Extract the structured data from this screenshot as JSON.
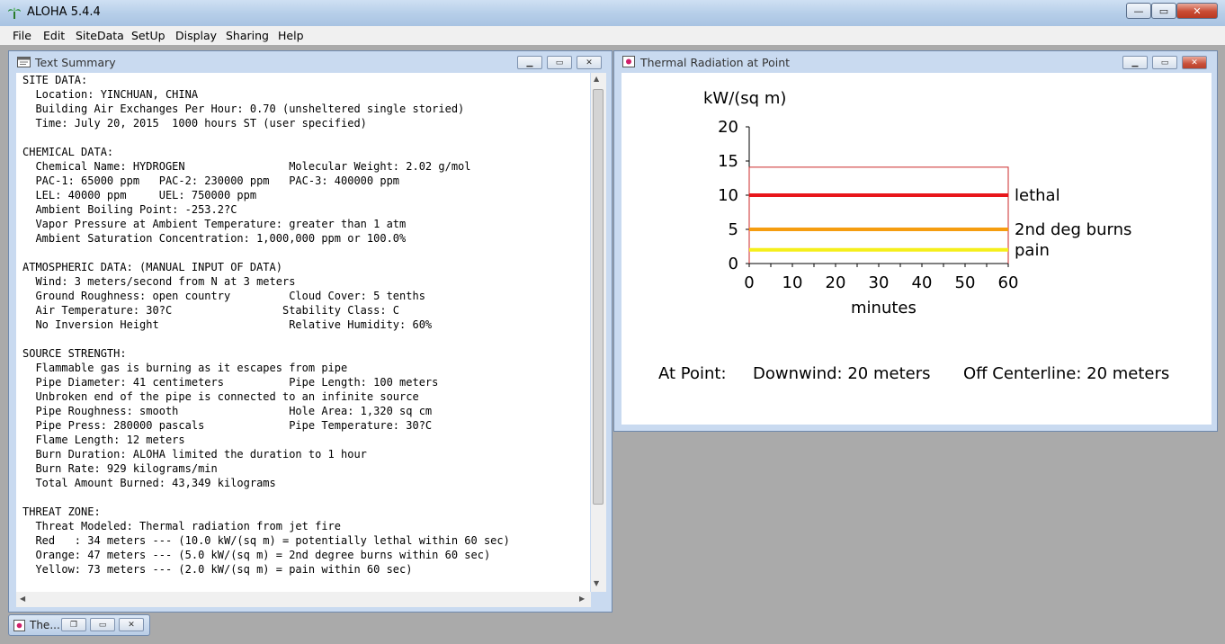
{
  "app": {
    "title": "ALOHA 5.4.4",
    "window_buttons": {
      "minimize": "—",
      "maximize": "▭",
      "close": "✕"
    }
  },
  "menu": [
    {
      "label": "File"
    },
    {
      "label": "Edit"
    },
    {
      "label": "SiteData"
    },
    {
      "label": "SetUp"
    },
    {
      "label": "Display"
    },
    {
      "label": "Sharing"
    },
    {
      "label": "Help"
    }
  ],
  "text_summary": {
    "title": "Text Summary",
    "lines": [
      "SITE DATA:",
      "  Location: YINCHUAN, CHINA",
      "  Building Air Exchanges Per Hour: 0.70 (unsheltered single storied)",
      "  Time: July 20, 2015  1000 hours ST (user specified)",
      "",
      "CHEMICAL DATA:",
      "  Chemical Name: HYDROGEN                Molecular Weight: 2.02 g/mol",
      "  PAC-1: 65000 ppm   PAC-2: 230000 ppm   PAC-3: 400000 ppm",
      "  LEL: 40000 ppm     UEL: 750000 ppm",
      "  Ambient Boiling Point: -253.2?C",
      "  Vapor Pressure at Ambient Temperature: greater than 1 atm",
      "  Ambient Saturation Concentration: 1,000,000 ppm or 100.0%",
      "",
      "ATMOSPHERIC DATA: (MANUAL INPUT OF DATA)",
      "  Wind: 3 meters/second from N at 3 meters",
      "  Ground Roughness: open country         Cloud Cover: 5 tenths",
      "  Air Temperature: 30?C                 Stability Class: C",
      "  No Inversion Height                    Relative Humidity: 60%",
      "",
      "SOURCE STRENGTH:",
      "  Flammable gas is burning as it escapes from pipe",
      "  Pipe Diameter: 41 centimeters          Pipe Length: 100 meters",
      "  Unbroken end of the pipe is connected to an infinite source",
      "  Pipe Roughness: smooth                 Hole Area: 1,320 sq cm",
      "  Pipe Press: 280000 pascals             Pipe Temperature: 30?C",
      "  Flame Length: 12 meters",
      "  Burn Duration: ALOHA limited the duration to 1 hour",
      "  Burn Rate: 929 kilograms/min",
      "  Total Amount Burned: 43,349 kilograms",
      "",
      "THREAT ZONE:",
      "  Threat Modeled: Thermal radiation from jet fire",
      "  Red   : 34 meters --- (10.0 kW/(sq m) = potentially lethal within 60 sec)",
      "  Orange: 47 meters --- (5.0 kW/(sq m) = 2nd degree burns within 60 sec)",
      "  Yellow: 73 meters --- (2.0 kW/(sq m) = pain within 60 sec)"
    ]
  },
  "thermal_window": {
    "title": "Thermal Radiation at Point",
    "footer": {
      "label": "At Point:",
      "downwind": "Downwind: 20 meters",
      "off_centerline": "Off Centerline: 20 meters"
    }
  },
  "chart_data": {
    "type": "line",
    "ylabel": "kW/(sq m)",
    "xlabel": "minutes",
    "xlim": [
      0,
      60
    ],
    "ylim": [
      0,
      20
    ],
    "x_ticks": [
      0,
      10,
      20,
      30,
      40,
      50,
      60
    ],
    "y_ticks": [
      0,
      5,
      10,
      15,
      20
    ],
    "series": [
      {
        "name": "lethal",
        "color": "#e8161b",
        "x": [
          0,
          60
        ],
        "values": [
          10,
          10
        ]
      },
      {
        "name": "2nd deg burns",
        "color": "#f59d10",
        "x": [
          0,
          60
        ],
        "values": [
          5,
          5
        ]
      },
      {
        "name": "pain",
        "color": "#f5ef1c",
        "x": [
          0,
          60
        ],
        "values": [
          2,
          2
        ]
      }
    ],
    "exposure_curve": {
      "color": "#cc2a2a",
      "x": [
        0,
        0,
        60,
        60
      ],
      "values": [
        0,
        14.1,
        14.1,
        0
      ]
    },
    "grid": false
  },
  "taskbar": {
    "minimized_label": "The..."
  }
}
